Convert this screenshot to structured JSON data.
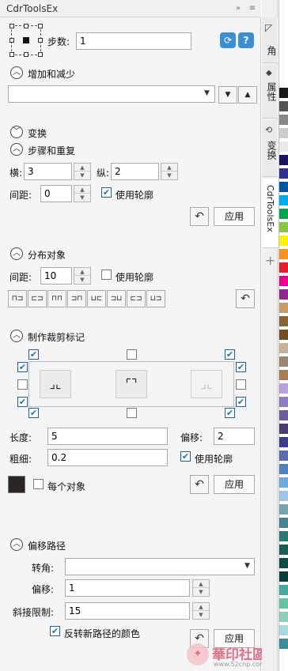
{
  "window": {
    "title": "CdrToolsEx",
    "pin_icon": "double-chevron-right-icon",
    "menu_icon": "menu-icon"
  },
  "top": {
    "step_label": "步数:",
    "step_value": "1"
  },
  "sections": {
    "add_remove": "增加和减少",
    "transform": "变换",
    "step_repeat": "步骤和重复",
    "distribute": "分布对象",
    "crop_marks": "制作裁剪标记",
    "offset_path": "偏移路径"
  },
  "step_repeat": {
    "horizontal_label": "横:",
    "horizontal_value": "3",
    "vertical_label": "纵:",
    "vertical_value": "2",
    "spacing_label": "间距:",
    "spacing_value": "0",
    "use_outline_label": "使用轮廓",
    "apply_label": "应用"
  },
  "distribute": {
    "spacing_label": "间距:",
    "spacing_value": "10",
    "use_outline_label": "使用轮廓"
  },
  "crop": {
    "length_label": "长度:",
    "length_value": "5",
    "offset_label": "偏移:",
    "offset_value": "2",
    "thickness_label": "粗细:",
    "thickness_value": "0.2",
    "use_outline_label": "使用轮廓",
    "each_object_label": "每个对象",
    "apply_label": "应用"
  },
  "offset_path": {
    "corner_label": "转角:",
    "corner_value": "",
    "offset_label": "偏移:",
    "offset_value": "1",
    "miter_label": "斜接限制:",
    "miter_value": "15",
    "reverse_label": "反转新路径的颜色",
    "apply_label": "应用"
  },
  "dock": {
    "tab1": "角",
    "tab2": "属性",
    "tab3": "变换",
    "tab4": "CdrToolsEx",
    "plus": "+"
  },
  "colors": {
    "accent": "#1e6fb8",
    "palette": [
      "#ffffff",
      "#ffffff",
      "#ffffff",
      "#1a1a1a",
      "#555555",
      "#888888",
      "#cccccc",
      "#e8e8e8",
      "#1b1464",
      "#2e3192",
      "#0054a6",
      "#00aeef",
      "#00a651",
      "#8dc63f",
      "#fff200",
      "#f7941d",
      "#ed1c24",
      "#ec008c",
      "#92278f",
      "#c69c6d",
      "#8c6239",
      "#754c24",
      "#c7b299",
      "#998675",
      "#a67c52",
      "#bca0dc",
      "#8e7cc3",
      "#6d5d9c",
      "#4b3f72",
      "#3d3d8f",
      "#5b6dae",
      "#4f81bd",
      "#6fa8dc",
      "#9fc5e8",
      "#76a5af",
      "#45818e",
      "#2c7873",
      "#1b5e57",
      "#0f4c45",
      "#0b3d3a",
      "#44aa99",
      "#66c2a5",
      "#8ecfb8",
      "#a8dadc",
      "#3c8d9c"
    ]
  },
  "watermark": {
    "text": "華印社區",
    "url": "www.52cnp.com"
  }
}
